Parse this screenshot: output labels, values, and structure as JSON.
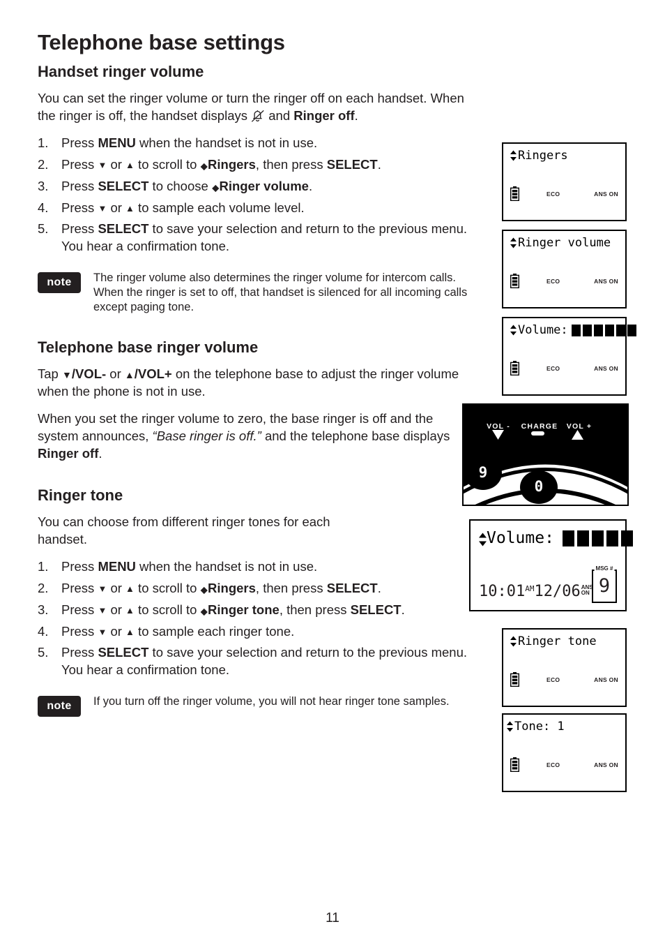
{
  "page": {
    "title": "Telephone base settings",
    "number": "11"
  },
  "sections": {
    "handset_ringer_volume": {
      "heading": "Handset ringer volume",
      "intro_part1": "You can set the ringer volume or turn the ringer off on each handset. When the ringer is off, the handset displays ",
      "intro_icon": "ringer-off-bell-icon",
      "intro_part2": " and ",
      "intro_bold": "Ringer off",
      "intro_end": ".",
      "steps": [
        {
          "num": "1.",
          "segments": [
            {
              "t": "Press ",
              "s": "plain"
            },
            {
              "t": "MENU",
              "s": "bold"
            },
            {
              "t": " when the handset is not in use.",
              "s": "plain"
            }
          ]
        },
        {
          "num": "2.",
          "segments": [
            {
              "t": "Press ",
              "s": "plain"
            },
            {
              "t": "▼",
              "s": "arrow"
            },
            {
              "t": " or ",
              "s": "plain"
            },
            {
              "t": "▲",
              "s": "arrow"
            },
            {
              "t": " to scroll to ",
              "s": "plain"
            },
            {
              "t": "⬥",
              "s": "updown"
            },
            {
              "t": "Ringers",
              "s": "bold"
            },
            {
              "t": ", then press ",
              "s": "plain"
            },
            {
              "t": "SELECT",
              "s": "bold"
            },
            {
              "t": ".",
              "s": "plain"
            }
          ]
        },
        {
          "num": "3.",
          "segments": [
            {
              "t": "Press ",
              "s": "plain"
            },
            {
              "t": "SELECT",
              "s": "bold"
            },
            {
              "t": " to choose ",
              "s": "plain"
            },
            {
              "t": "⬥",
              "s": "updown"
            },
            {
              "t": "Ringer volume",
              "s": "bold"
            },
            {
              "t": ".",
              "s": "plain"
            }
          ]
        },
        {
          "num": "4.",
          "segments": [
            {
              "t": "Press ",
              "s": "plain"
            },
            {
              "t": "▼",
              "s": "arrow"
            },
            {
              "t": " or ",
              "s": "plain"
            },
            {
              "t": "▲",
              "s": "arrow"
            },
            {
              "t": " to sample each volume level.",
              "s": "plain"
            }
          ]
        },
        {
          "num": "5.",
          "segments": [
            {
              "t": "Press ",
              "s": "plain"
            },
            {
              "t": "SELECT",
              "s": "bold"
            },
            {
              "t": " to save your selection and return to the previous menu. You hear a confirmation tone.",
              "s": "plain"
            }
          ]
        }
      ],
      "note": {
        "badge": "note",
        "text": "The ringer volume also determines the ringer volume for intercom calls. When the ringer is set to off, that handset is silenced for all incoming calls except paging tone."
      }
    },
    "telephone_base_ringer_volume": {
      "heading": "Telephone base ringer volume",
      "para1_segments": [
        {
          "t": "Tap ",
          "s": "plain"
        },
        {
          "t": "▼",
          "s": "bigarrow"
        },
        {
          "t": "/VOL-",
          "s": "bold"
        },
        {
          "t": " or ",
          "s": "plain"
        },
        {
          "t": "▲",
          "s": "bigarrow"
        },
        {
          "t": "/VOL+",
          "s": "bold"
        },
        {
          "t": " on the telephone base to adjust the ringer volume when the phone is not in use.",
          "s": "plain"
        }
      ],
      "para2_segments": [
        {
          "t": "When you set the ringer volume to zero, the base ringer is off and the system announces, ",
          "s": "plain"
        },
        {
          "t": "“Base ringer is off.”",
          "s": "italic"
        },
        {
          "t": " and the telephone base displays ",
          "s": "plain"
        },
        {
          "t": "Ringer off",
          "s": "bold"
        },
        {
          "t": ".",
          "s": "plain"
        }
      ]
    },
    "ringer_tone": {
      "heading": "Ringer tone",
      "intro": "You can choose from different ringer tones for each handset.",
      "steps": [
        {
          "num": "1.",
          "segments": [
            {
              "t": "Press ",
              "s": "plain"
            },
            {
              "t": "MENU",
              "s": "bold"
            },
            {
              "t": " when the handset is not in use.",
              "s": "plain"
            }
          ]
        },
        {
          "num": "2.",
          "segments": [
            {
              "t": "Press ",
              "s": "plain"
            },
            {
              "t": "▼",
              "s": "arrow"
            },
            {
              "t": " or ",
              "s": "plain"
            },
            {
              "t": "▲",
              "s": "arrow"
            },
            {
              "t": " to scroll to ",
              "s": "plain"
            },
            {
              "t": "⬥",
              "s": "updown"
            },
            {
              "t": "Ringers",
              "s": "bold"
            },
            {
              "t": ", then press ",
              "s": "plain"
            },
            {
              "t": "SELECT",
              "s": "bold"
            },
            {
              "t": ".",
              "s": "plain"
            }
          ]
        },
        {
          "num": "3.",
          "segments": [
            {
              "t": "Press ",
              "s": "plain"
            },
            {
              "t": "▼",
              "s": "arrow"
            },
            {
              "t": " or ",
              "s": "plain"
            },
            {
              "t": "▲",
              "s": "arrow"
            },
            {
              "t": " to scroll to ",
              "s": "plain"
            },
            {
              "t": "⬥",
              "s": "updown"
            },
            {
              "t": "Ringer tone",
              "s": "bold"
            },
            {
              "t": ", then press ",
              "s": "plain"
            },
            {
              "t": "SELECT",
              "s": "bold"
            },
            {
              "t": ".",
              "s": "plain"
            }
          ]
        },
        {
          "num": "4.",
          "segments": [
            {
              "t": "Press ",
              "s": "plain"
            },
            {
              "t": "▼",
              "s": "arrow"
            },
            {
              "t": " or ",
              "s": "plain"
            },
            {
              "t": "▲",
              "s": "arrow"
            },
            {
              "t": " to sample each ringer tone.",
              "s": "plain"
            }
          ]
        },
        {
          "num": "5.",
          "segments": [
            {
              "t": "Press ",
              "s": "plain"
            },
            {
              "t": "SELECT",
              "s": "bold"
            },
            {
              "t": " to save your selection and return to the previous menu. You hear a confirmation tone.",
              "s": "plain"
            }
          ]
        }
      ],
      "note": {
        "badge": "note",
        "text": "If you turn off the ringer volume, you will not hear ringer tone samples."
      }
    }
  },
  "illustrations": {
    "lcd_screens": [
      {
        "id": "lcd-ringers",
        "line1": "Ringers",
        "has_updown_arrow": true,
        "volume_blocks": 0,
        "eco": "ECO",
        "ans": "ANS ON"
      },
      {
        "id": "lcd-ringer-volume",
        "line1": "Ringer volume",
        "has_updown_arrow": true,
        "volume_blocks": 0,
        "eco": "ECO",
        "ans": "ANS ON"
      },
      {
        "id": "lcd-volume-level",
        "line1": "Volume:",
        "has_updown_arrow": true,
        "volume_blocks": 6,
        "eco": "ECO",
        "ans": "ANS ON"
      },
      {
        "id": "lcd-ringer-tone",
        "line1": "Ringer tone",
        "has_updown_arrow": true,
        "volume_blocks": 0,
        "eco": "ECO",
        "ans": "ANS ON"
      },
      {
        "id": "lcd-tone-1",
        "line1": "Tone: 1",
        "has_updown_arrow": true,
        "volume_blocks": 0,
        "eco": "ECO",
        "ans": "ANS ON"
      }
    ],
    "telephone_base": {
      "vol_down_label": "VOL -",
      "charge_label": "CHARGE",
      "vol_up_label": "VOL +",
      "key_9": "9",
      "key_0": "0",
      "speaker_icon": "speaker-icon"
    },
    "base_lcd": {
      "line1": "Volume:",
      "volume_blocks": 5,
      "time": "10:01",
      "ampm": "AM",
      "date": "12/06",
      "ans_line1": "ANS",
      "ans_line2": "ON",
      "msg_label": "MSG #",
      "msg_count": "9"
    }
  },
  "colors": {
    "ink": "#231f20",
    "base_body": "#000000",
    "paper": "#ffffff"
  }
}
